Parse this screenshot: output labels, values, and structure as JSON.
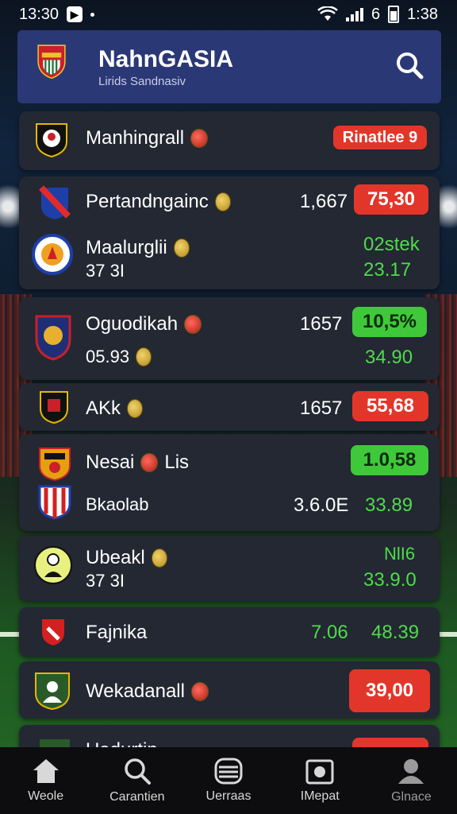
{
  "status": {
    "time_left": "13:30",
    "signal_num": "6",
    "time_right": "1:38"
  },
  "header": {
    "title": "NahnGASIA",
    "subtitle": "Lirids Sandnasiv"
  },
  "colors": {
    "red": "#e3362a",
    "green": "#3fc93a",
    "header": "#2b3876",
    "card": "#232833"
  },
  "matches": [
    {
      "team": "Manhingrall",
      "badge": "Rinatlee 9"
    },
    {
      "team": "Pertandngainc",
      "value": "1,667",
      "odds": "75,30"
    },
    {
      "team": "Maalurglii",
      "sub": "37 3I",
      "change": "02stek",
      "change2": "23.17"
    },
    {
      "team": "Oguodikah",
      "value": "1657",
      "odds": "10,5%",
      "sub": "05.93",
      "change": "34.90"
    },
    {
      "team": "AKk",
      "value": "1657",
      "odds": "55,68"
    },
    {
      "team": "Nesai",
      "team_b": "Lis",
      "odds": "1.0,58",
      "sub": "Bkaolab",
      "value": "3.6.0E",
      "change": "33.89"
    },
    {
      "team": "Ubeakl",
      "sub": "37 3I",
      "change": "NlI6",
      "change2": "33.9.0"
    },
    {
      "team": "Fajnika",
      "value": "7.06",
      "change": "48.39"
    },
    {
      "team": "Wekadanall",
      "odds": "39,00"
    },
    {
      "team": "Uadurtin"
    }
  ],
  "nav": [
    {
      "label": "Weole",
      "icon": "home-icon"
    },
    {
      "label": "Carantien",
      "icon": "search-icon"
    },
    {
      "label": "Uerraas",
      "icon": "list-icon"
    },
    {
      "label": "IMepat",
      "icon": "camera-icon"
    },
    {
      "label": "Glnace",
      "icon": "profile-icon"
    }
  ]
}
